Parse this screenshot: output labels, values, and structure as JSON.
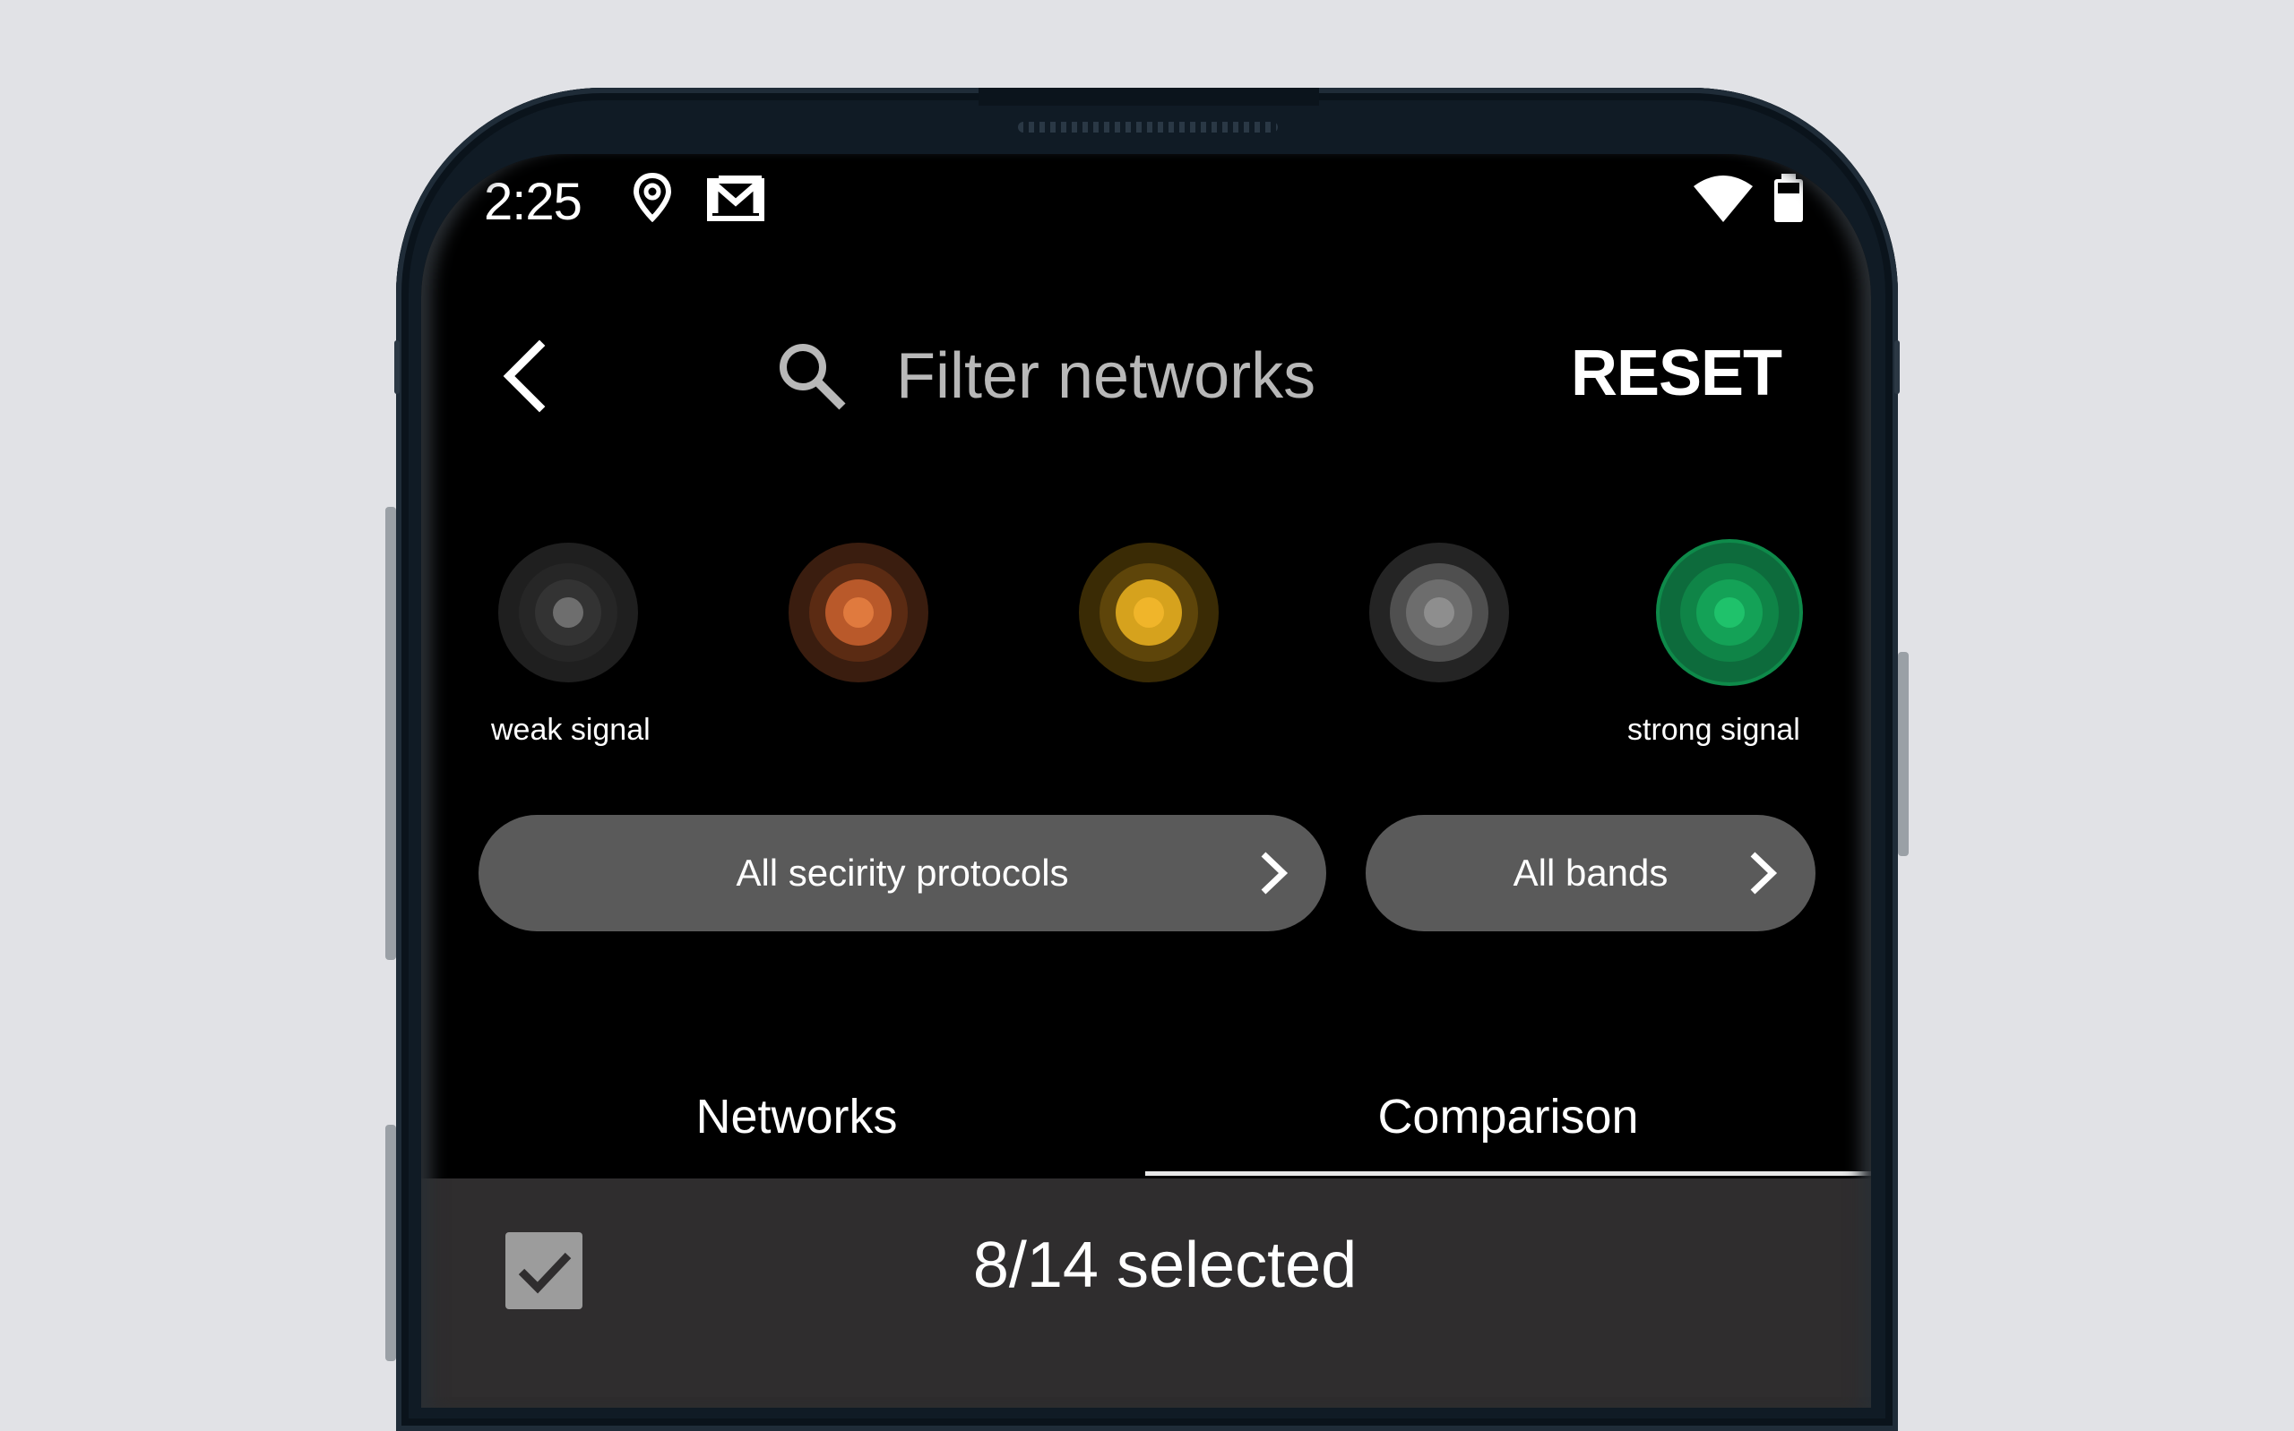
{
  "status_bar": {
    "time": "2:25",
    "icons": [
      "location-icon",
      "gmail-icon",
      "wifi-icon",
      "battery-icon"
    ]
  },
  "toolbar": {
    "back_icon": "chevron-left-icon",
    "search_icon": "search-icon",
    "search_placeholder": "Filter networks",
    "reset_label": "RESET"
  },
  "signal_filter": {
    "levels": [
      {
        "name": "weakest",
        "color": "#6e6e6e"
      },
      {
        "name": "weak",
        "color": "#e07a3e"
      },
      {
        "name": "medium",
        "color": "#f0b52a"
      },
      {
        "name": "good",
        "color": "#8e8e8e"
      },
      {
        "name": "strongest",
        "color": "#1fc26b"
      }
    ],
    "weak_label": "weak signal",
    "strong_label": "strong signal"
  },
  "filters": {
    "security_label": "All secirity protocols",
    "bands_label": "All bands"
  },
  "tabs": [
    {
      "label": "Networks",
      "selected": false
    },
    {
      "label": "Comparison",
      "selected": true
    }
  ],
  "selection": {
    "checked": true,
    "count_text": "8/14 selected"
  }
}
